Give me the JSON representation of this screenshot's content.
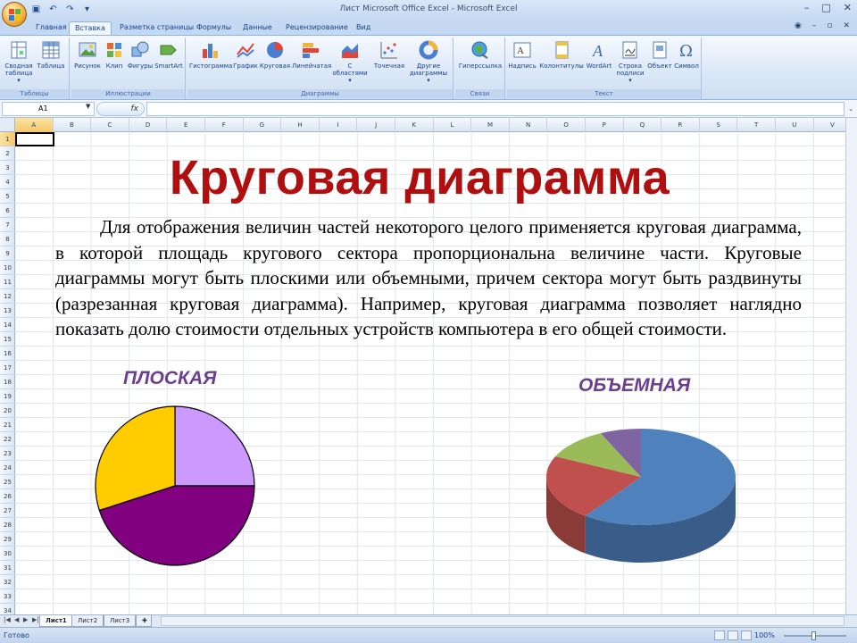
{
  "window": {
    "title": "Лист Microsoft Office Excel - Microsoft Excel",
    "controls": [
      "–",
      "□",
      "✕"
    ]
  },
  "tabs": [
    {
      "label": "Главная"
    },
    {
      "label": "Вставка"
    },
    {
      "label": "Разметка страницы"
    },
    {
      "label": "Формулы"
    },
    {
      "label": "Данные"
    },
    {
      "label": "Рецензирование"
    },
    {
      "label": "Вид"
    }
  ],
  "active_tab": "Вставка",
  "ribbon": {
    "groups": {
      "tables": "Таблицы",
      "illustrations": "Иллюстрации",
      "charts": "Диаграммы",
      "links": "Связи",
      "text": "Текст"
    },
    "buttons": {
      "pivot_l1": "Сводная",
      "pivot_l2": "таблица ▾",
      "table": "Таблица",
      "picture": "Рисунок",
      "clip": "Клип",
      "shapes": "Фигуры",
      "smartart": "SmartArt",
      "histogram": "Гистограмма",
      "graph": "График",
      "pie": "Круговая",
      "bar": "Линейчатая",
      "area_l1": "С",
      "area_l2": "областями ▾",
      "scatter": "Точечная",
      "other_l1": "Другие",
      "other_l2": "диаграммы ▾",
      "hyperlink": "Гиперссылка",
      "textbox": "Надпись",
      "header": "Колонтитулы",
      "wordart": "WordArt",
      "sig_l1": "Строка",
      "sig_l2": "подписи ▾",
      "object": "Объект",
      "symbol": "Символ"
    }
  },
  "formula_bar": {
    "name_box": "A1",
    "fx": "fx",
    "value": ""
  },
  "columns": [
    "A",
    "B",
    "C",
    "D",
    "E",
    "F",
    "G",
    "H",
    "I",
    "J",
    "K",
    "L",
    "M",
    "N",
    "O",
    "P",
    "Q",
    "R",
    "S",
    "T",
    "U",
    "V"
  ],
  "rows": [
    "1",
    "2",
    "3",
    "4",
    "5",
    "6",
    "7",
    "8",
    "9",
    "10",
    "11",
    "12",
    "13",
    "14",
    "15",
    "16",
    "17",
    "18",
    "19",
    "20",
    "21",
    "22",
    "23",
    "24",
    "25",
    "26",
    "27",
    "28",
    "29",
    "30",
    "31",
    "32",
    "33",
    "34"
  ],
  "content": {
    "title": "Круговая диаграмма",
    "paragraph": "Для отображения величин частей некоторого целого применяется круговая диаграмма, в которой площадь кругового сектора пропорциональна величине части. Круговые диаграммы могут быть плоскими или объемными, причем сектора могут быть раздвинуты (разрезанная круговая диаграмма). Например, круговая диаграмма позволяет наглядно показать долю стоимости отдельных устройств компьютера в его общей стоимости.",
    "flat_label": "ПЛОСКАЯ",
    "volume_label": "ОБЪЕМНАЯ"
  },
  "chart_data": [
    {
      "type": "pie",
      "title": "",
      "values": [
        25,
        45,
        30
      ],
      "colors": [
        "#cc99ff",
        "#800080",
        "#ffcc00"
      ]
    },
    {
      "type": "pie",
      "title": "",
      "values": [
        60,
        22,
        11,
        7
      ],
      "colors": [
        "#4f81bd",
        "#c0504d",
        "#9bbb59",
        "#8064a2"
      ]
    }
  ],
  "sheet_tabs": [
    "Лист1",
    "Лист2",
    "Лист3"
  ],
  "active_sheet": "Лист1",
  "status": {
    "text": "Готово",
    "zoom": "100%"
  }
}
